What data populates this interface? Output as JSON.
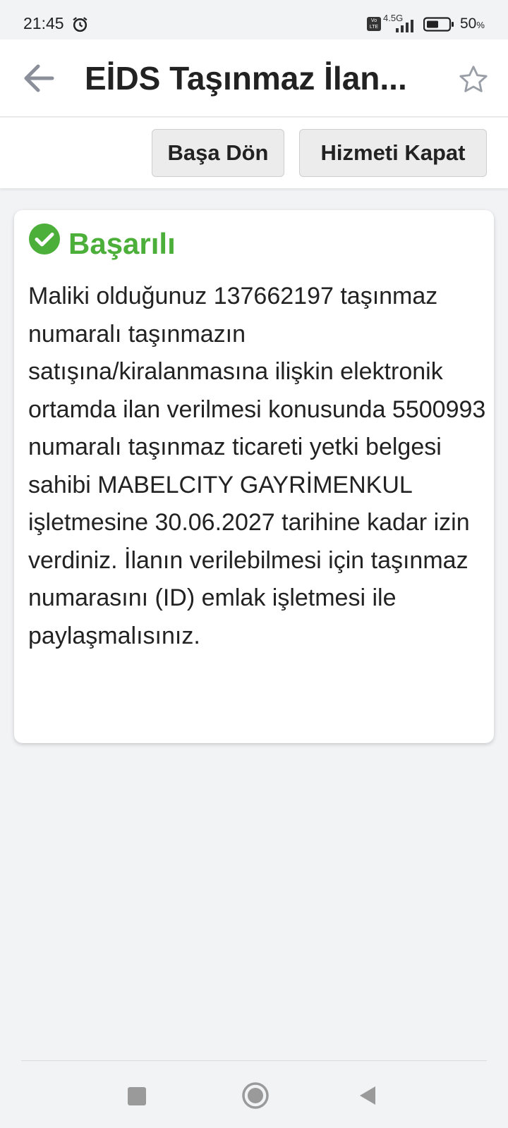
{
  "status_bar": {
    "time": "21:45",
    "network_label": "4.5G",
    "volte_label": "Vo LTE",
    "battery_percent": "50",
    "battery_unit": "%",
    "battery_level": 0.5,
    "icons": [
      "alarm-icon",
      "volte-icon",
      "signal-icon",
      "battery-icon"
    ]
  },
  "app_bar": {
    "title": "EİDS Taşınmaz İlan...",
    "back_icon": "arrow-left-icon",
    "favorite_icon": "star-outline-icon"
  },
  "toolbar": {
    "home_button_label": "Başa Dön",
    "close_service_label": "Hizmeti Kapat"
  },
  "result": {
    "status_icon": "check-circle-icon",
    "title": "Başarılı",
    "message": "Maliki olduğunuz 137662197 taşınmaz numaralı taşınmazın satışına/kiralanmasına ilişkin elektronik ortamda ilan verilmesi konusunda 5500993 numaralı taşınmaz ticareti yetki belgesi sahibi MABELCITY GAYRİMENKUL işletmesine 30.06.2027 tarihine kadar izin verdiniz. İlanın verilebilmesi için taşınmaz numarasını (ID) emlak işletmesi ile paylaşmalısınız."
  },
  "navigation": {
    "icons": [
      "recents-square-icon",
      "home-circle-icon",
      "back-triangle-icon"
    ]
  },
  "colors": {
    "success": "#4caf3a",
    "text": "#222222",
    "background": "#f2f3f5",
    "button_bg": "#ececec"
  }
}
